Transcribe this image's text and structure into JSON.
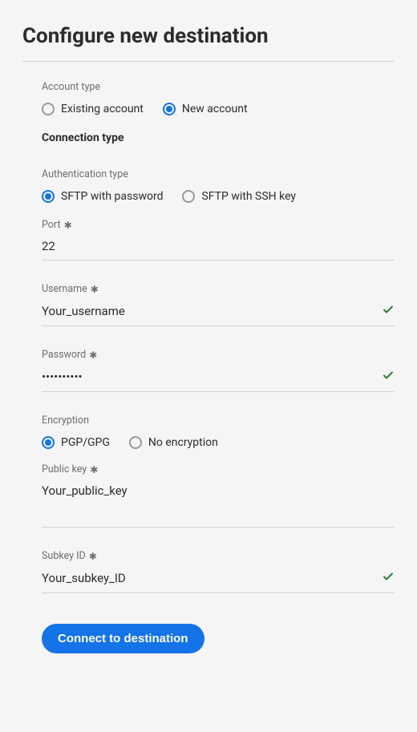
{
  "page_title": "Configure new destination",
  "account_type": {
    "label": "Account type",
    "options": [
      {
        "label": "Existing account",
        "selected": false
      },
      {
        "label": "New account",
        "selected": true
      }
    ]
  },
  "connection_type_title": "Connection type",
  "authentication_type": {
    "label": "Authentication type",
    "options": [
      {
        "label": "SFTP with password",
        "selected": true
      },
      {
        "label": "SFTP with SSH key",
        "selected": false
      }
    ]
  },
  "fields": {
    "port": {
      "label": "Port",
      "required": true,
      "value": "22",
      "valid": false
    },
    "username": {
      "label": "Username",
      "required": true,
      "value": "Your_username",
      "valid": true
    },
    "password": {
      "label": "Password",
      "required": true,
      "value": "••••••••••",
      "valid": true
    },
    "public_key": {
      "label": "Public key",
      "required": true,
      "value": "Your_public_key",
      "valid": false
    },
    "subkey_id": {
      "label": "Subkey ID",
      "required": true,
      "value": "Your_subkey_ID",
      "valid": true
    }
  },
  "encryption": {
    "label": "Encryption",
    "options": [
      {
        "label": "PGP/GPG",
        "selected": true
      },
      {
        "label": "No encryption",
        "selected": false
      }
    ]
  },
  "submit_button": "Connect to destination",
  "required_symbol": "✱"
}
